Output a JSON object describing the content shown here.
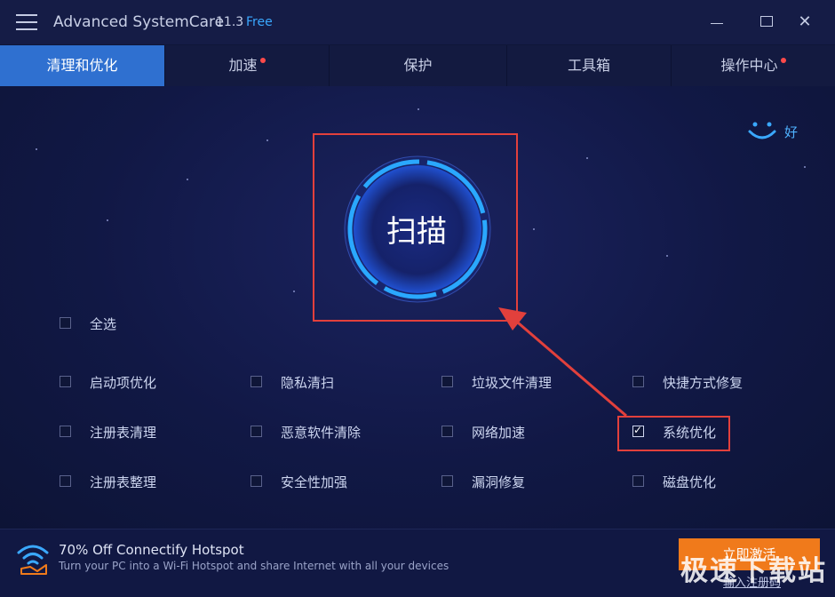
{
  "titlebar": {
    "app_name": "Advanced SystemCare",
    "version": "11.3",
    "edition": "Free"
  },
  "tabs": [
    {
      "label": "清理和优化",
      "active": true,
      "has_dot": false
    },
    {
      "label": "加速",
      "active": false,
      "has_dot": true
    },
    {
      "label": "保护",
      "active": false,
      "has_dot": false
    },
    {
      "label": "工具箱",
      "active": false,
      "has_dot": false
    },
    {
      "label": "操作中心",
      "active": false,
      "has_dot": true
    }
  ],
  "status": {
    "text": "好",
    "icon": "smiley-icon"
  },
  "scan": {
    "label": "扫描"
  },
  "select_all": {
    "label": "全选",
    "checked": false
  },
  "options": [
    {
      "label": "启动项优化",
      "checked": false
    },
    {
      "label": "隐私清扫",
      "checked": false
    },
    {
      "label": "垃圾文件清理",
      "checked": false
    },
    {
      "label": "快捷方式修复",
      "checked": false
    },
    {
      "label": "注册表清理",
      "checked": false
    },
    {
      "label": "恶意软件清除",
      "checked": false
    },
    {
      "label": "网络加速",
      "checked": false
    },
    {
      "label": "系统优化",
      "checked": true
    },
    {
      "label": "注册表整理",
      "checked": false
    },
    {
      "label": "安全性加强",
      "checked": false
    },
    {
      "label": "漏洞修复",
      "checked": false
    },
    {
      "label": "磁盘优化",
      "checked": false
    }
  ],
  "footer": {
    "promo_title": "70% Off Connectify Hotspot",
    "promo_subtitle": "Turn your PC into a Wi-Fi Hotspot and share Internet with all your devices",
    "activate_label": "立即激活",
    "register_label": "输入注册码",
    "watermark": "极速下载站"
  },
  "colors": {
    "accent": "#2f70d0",
    "highlight": "#e2403c",
    "activate": "#f07a1b",
    "ring": "#2aa8ff"
  }
}
